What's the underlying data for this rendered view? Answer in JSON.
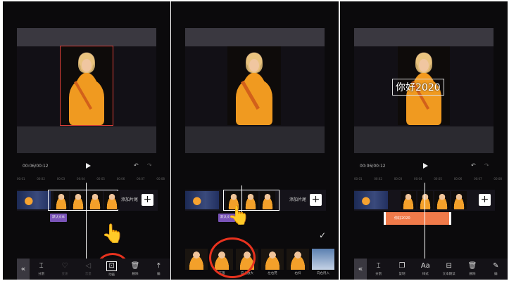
{
  "p1": {
    "time": "00:06/00:12",
    "ruler": [
      "00:01",
      "00:02",
      "00:03",
      "00:04",
      "00:05",
      "00:06",
      "00:07",
      "00:08"
    ],
    "add_end": "添加片尾",
    "chip": "默认文本",
    "tools": [
      {
        "icon": "⌶",
        "label": "分割"
      },
      {
        "icon": "♡",
        "label": "变速"
      },
      {
        "icon": "◁",
        "label": "音量"
      },
      {
        "icon": "⊡",
        "label": "动画"
      },
      {
        "icon": "🗑",
        "label": "删除"
      },
      {
        "icon": "⤒",
        "label": "编"
      }
    ]
  },
  "p2": {
    "chip": "默认文本",
    "add_end": "添加片尾",
    "effects": [
      "",
      "下落",
      "向上放大",
      "左右晃",
      "右抖",
      "向右甩入"
    ]
  },
  "p3": {
    "title_text": "你好2020",
    "chip": "你好2020",
    "tools": [
      {
        "icon": "⌶",
        "label": "分割"
      },
      {
        "icon": "❐",
        "label": "复制"
      },
      {
        "icon": "Aa",
        "label": "样式"
      },
      {
        "icon": "⊟",
        "label": "文本朗读"
      },
      {
        "icon": "🗑",
        "label": "删除"
      },
      {
        "icon": "✎",
        "label": "编"
      }
    ]
  },
  "icons": {
    "back": "«",
    "play": "play-icon",
    "undo": "↶",
    "redo": "↷",
    "plus": "+",
    "check": "✓",
    "hand": "👆"
  }
}
